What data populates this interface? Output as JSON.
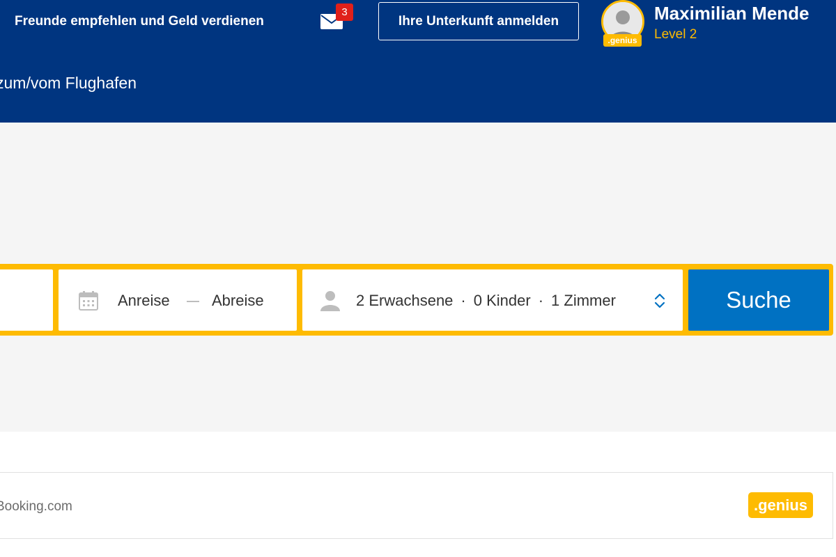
{
  "header": {
    "refer_link": "Freunde empfehlen und Geld verdienen",
    "inbox_count": "3",
    "register_button": "Ihre Unterkunft anmelden",
    "avatar_badge": ".genius",
    "user_name": "Maximilian Mende",
    "user_level": "Level 2",
    "nav_item": "zum/vom Flughafen"
  },
  "search": {
    "checkin_label": "Anreise",
    "checkout_label": "Abreise",
    "adults": "2 Erwachsene",
    "children": "0 Kinder",
    "rooms": "1 Zimmer",
    "separator": "·",
    "search_button": "Suche"
  },
  "footer_row": {
    "text": "Booking.com",
    "genius_badge": ".genius"
  },
  "colors": {
    "brand_blue": "#003580",
    "accent_yellow": "#febb02",
    "button_blue": "#0071c2",
    "badge_red": "#e0201a"
  },
  "icons": {
    "mail": "envelope-icon",
    "calendar": "calendar-icon",
    "person": "person-icon",
    "stepper": "chevron-updown-icon"
  }
}
